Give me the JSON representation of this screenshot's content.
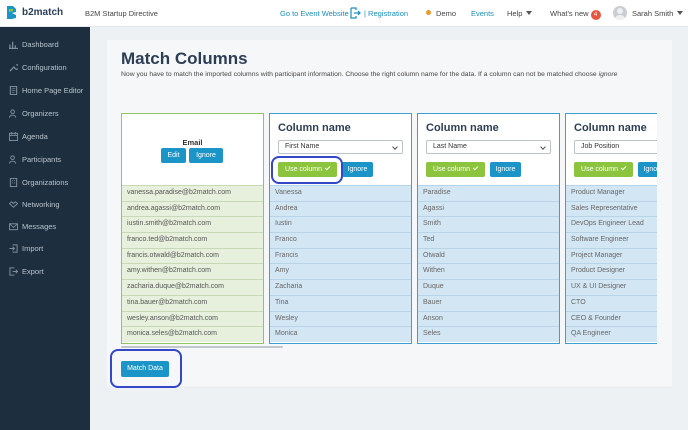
{
  "header": {
    "brand": "b2match",
    "event_name": "B2M Startup Directive",
    "links": {
      "event_website": "Go to Event Website",
      "registration": "| Registration",
      "demo": "Demo",
      "events": "Events",
      "help": "Help",
      "whats_new": "What's new",
      "whats_new_count": "4"
    },
    "user": "Sarah Smith"
  },
  "sidebar": {
    "items": [
      {
        "label": "Dashboard",
        "icon": "dashboard-icon"
      },
      {
        "label": "Configuration",
        "icon": "wrench-icon"
      },
      {
        "label": "Home Page Editor",
        "icon": "page-icon"
      },
      {
        "label": "Organizers",
        "icon": "users-icon"
      },
      {
        "label": "Agenda",
        "icon": "calendar-icon"
      },
      {
        "label": "Participants",
        "icon": "users-icon"
      },
      {
        "label": "Organizations",
        "icon": "building-icon"
      },
      {
        "label": "Networking",
        "icon": "handshake-icon"
      },
      {
        "label": "Messages",
        "icon": "mail-icon"
      },
      {
        "label": "Import",
        "icon": "import-icon"
      },
      {
        "label": "Export",
        "icon": "export-icon"
      }
    ]
  },
  "main": {
    "title": "Match Columns",
    "description": "Now you have to match the imported columns with participant information. Choose the right column name for the data. If a column can not be matched choose ",
    "description_em": "ignore",
    "email_column": {
      "label": "Email",
      "edit": "Edit",
      "ignore": "Ignore",
      "values": [
        "vanessa.paradise@b2match.com",
        "andrea.agassi@b2match.com",
        "iustin.smith@b2match.com",
        "franco.ted@b2match.com",
        "francis.otwald@b2match.com",
        "amy.withen@b2match.com",
        "zacharia.duque@b2match.com",
        "tina.bauer@b2match.com",
        "wesley.anson@b2match.com",
        "monica.seles@b2match.com"
      ]
    },
    "column_title": "Column name",
    "use_column": "Use column",
    "ignore": "Ignore",
    "columns": [
      {
        "selected": "First Name",
        "values": [
          "Vanessa",
          "Andrea",
          "Iustin",
          "Franco",
          "Francis",
          "Amy",
          "Zacharia",
          "Tina",
          "Wesley",
          "Monica"
        ]
      },
      {
        "selected": "Last Name",
        "values": [
          "Paradise",
          "Agassi",
          "Smith",
          "Ted",
          "Otwald",
          "Withen",
          "Duque",
          "Bauer",
          "Anson",
          "Seles"
        ]
      },
      {
        "selected": "Job Position",
        "values": [
          "Product Manager",
          "Sales Representative",
          "DevOps Engineer Lead",
          "Software Engineer",
          "Project Manager",
          "Product Designer",
          "UX & UI Designer",
          "CTO",
          "CEO & Founder",
          "QA Engineer"
        ]
      }
    ],
    "match_data": "Match Data"
  },
  "colors": {
    "accent": "#1b95c8",
    "green": "#8cc43d",
    "sidebar": "#1d2f3e",
    "highlight": "#3347c8"
  }
}
